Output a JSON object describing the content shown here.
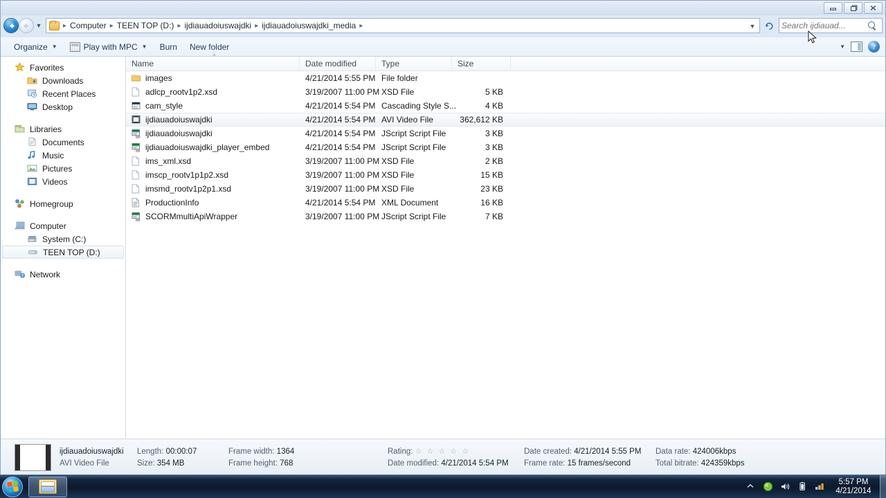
{
  "window": {
    "controls": {
      "minimize": "Minimize",
      "maximize": "Maximize",
      "close": "Close"
    }
  },
  "address": {
    "crumbs": [
      "Computer",
      "TEEN TOP (D:)",
      "ijdiauadoiuswajdki",
      "ijdiauadoiuswajdki_media"
    ],
    "separator": "▸",
    "dropdown_icon": "chevron-down-icon",
    "refresh_icon": "refresh-icon",
    "back_label": "Back",
    "forward_label": "Forward",
    "history_label": "Recent pages"
  },
  "search": {
    "placeholder": "Search ijdiauad...",
    "value": "",
    "icon": "search-icon"
  },
  "toolbar": {
    "organize": "Organize",
    "play_with": "Play with MPC",
    "burn": "Burn",
    "new_folder": "New folder",
    "caret": "▼",
    "change_view": "Change your view",
    "help": "?"
  },
  "navpane": {
    "groups": [
      {
        "header": {
          "label": "Favorites",
          "icon": "star-icon"
        },
        "items": [
          {
            "label": "Downloads",
            "icon": "downloads-icon"
          },
          {
            "label": "Recent Places",
            "icon": "recent-places-icon"
          },
          {
            "label": "Desktop",
            "icon": "desktop-icon"
          }
        ]
      },
      {
        "header": {
          "label": "Libraries",
          "icon": "libraries-icon"
        },
        "items": [
          {
            "label": "Documents",
            "icon": "documents-icon"
          },
          {
            "label": "Music",
            "icon": "music-icon"
          },
          {
            "label": "Pictures",
            "icon": "pictures-icon"
          },
          {
            "label": "Videos",
            "icon": "videos-icon"
          }
        ]
      },
      {
        "header": {
          "label": "Homegroup",
          "icon": "homegroup-icon"
        },
        "items": []
      },
      {
        "header": {
          "label": "Computer",
          "icon": "computer-icon"
        },
        "items": [
          {
            "label": "System (C:)",
            "icon": "harddisk-icon",
            "selected": false
          },
          {
            "label": "TEEN TOP (D:)",
            "icon": "removable-drive-icon",
            "selected": true
          }
        ]
      },
      {
        "header": {
          "label": "Network",
          "icon": "network-icon"
        },
        "items": []
      }
    ]
  },
  "filelist": {
    "columns": [
      {
        "label": "Name"
      },
      {
        "label": "Date modified"
      },
      {
        "label": "Type"
      },
      {
        "label": "Size"
      }
    ],
    "sort_indicator": "▴",
    "rows": [
      {
        "name": "images",
        "date": "4/21/2014 5:55 PM",
        "type": "File folder",
        "size": "",
        "icon": "folder-icon",
        "selected": false
      },
      {
        "name": "adlcp_rootv1p2.xsd",
        "date": "3/19/2007 11:00 PM",
        "type": "XSD File",
        "size": "5 KB",
        "icon": "blank-document-icon",
        "selected": false
      },
      {
        "name": "cam_style",
        "date": "4/21/2014 5:54 PM",
        "type": "Cascading Style S...",
        "size": "4 KB",
        "icon": "stylesheet-icon",
        "selected": false
      },
      {
        "name": "ijdiauadoiuswajdki",
        "date": "4/21/2014 5:54 PM",
        "type": "AVI Video File",
        "size": "362,612 KB",
        "icon": "video-file-icon",
        "selected": true
      },
      {
        "name": "ijdiauadoiuswajdki",
        "date": "4/21/2014 5:54 PM",
        "type": "JScript Script File",
        "size": "3 KB",
        "icon": "script-file-icon",
        "selected": false
      },
      {
        "name": "ijdiauadoiuswajdki_player_embed",
        "date": "4/21/2014 5:54 PM",
        "type": "JScript Script File",
        "size": "3 KB",
        "icon": "script-file-icon",
        "selected": false
      },
      {
        "name": "ims_xml.xsd",
        "date": "3/19/2007 11:00 PM",
        "type": "XSD File",
        "size": "2 KB",
        "icon": "blank-document-icon",
        "selected": false
      },
      {
        "name": "imscp_rootv1p1p2.xsd",
        "date": "3/19/2007 11:00 PM",
        "type": "XSD File",
        "size": "15 KB",
        "icon": "blank-document-icon",
        "selected": false
      },
      {
        "name": "imsmd_rootv1p2p1.xsd",
        "date": "3/19/2007 11:00 PM",
        "type": "XSD File",
        "size": "23 KB",
        "icon": "blank-document-icon",
        "selected": false
      },
      {
        "name": "ProductionInfo",
        "date": "4/21/2014 5:54 PM",
        "type": "XML Document",
        "size": "16 KB",
        "icon": "xml-document-icon",
        "selected": false
      },
      {
        "name": "SCORMmultiApiWrapper",
        "date": "3/19/2007 11:00 PM",
        "type": "JScript Script File",
        "size": "7 KB",
        "icon": "script-file-icon",
        "selected": false
      }
    ]
  },
  "details": {
    "file_name": "ijdiauadoiuswajdki",
    "file_type": "AVI Video File",
    "length_label": "Length:",
    "length_value": "00:00:07",
    "size_label": "Size:",
    "size_value": "354 MB",
    "frame_width_label": "Frame width:",
    "frame_width_value": "1364",
    "frame_height_label": "Frame height:",
    "frame_height_value": "768",
    "rating_label": "Rating:",
    "rating_stars": "☆ ☆ ☆ ☆ ☆",
    "date_modified_label": "Date modified:",
    "date_modified_value": "4/21/2014 5:54 PM",
    "date_created_label": "Date created:",
    "date_created_value": "4/21/2014 5:55 PM",
    "frame_rate_label": "Frame rate:",
    "frame_rate_value": "15 frames/second",
    "data_rate_label": "Data rate:",
    "data_rate_value": "424006kbps",
    "total_bitrate_label": "Total bitrate:",
    "total_bitrate_value": "424359kbps",
    "thumbnail_icon": "film-strip-icon"
  },
  "taskbar": {
    "start_label": "Start",
    "explorer_label": "Windows Explorer",
    "tray": [
      {
        "icon": "show-hidden-icons-icon"
      },
      {
        "icon": "security-shield-icon"
      },
      {
        "icon": "volume-icon"
      },
      {
        "icon": "battery-icon"
      },
      {
        "icon": "network-tray-icon"
      }
    ],
    "clock_time": "5:57 PM",
    "clock_date": "4/21/2014",
    "show_desktop_label": "Show desktop"
  },
  "colors": {
    "accent": "#2b8fd6",
    "folder": "#efb94e",
    "taskbar": "#0c1a2e",
    "selection": "#eef2f7"
  }
}
